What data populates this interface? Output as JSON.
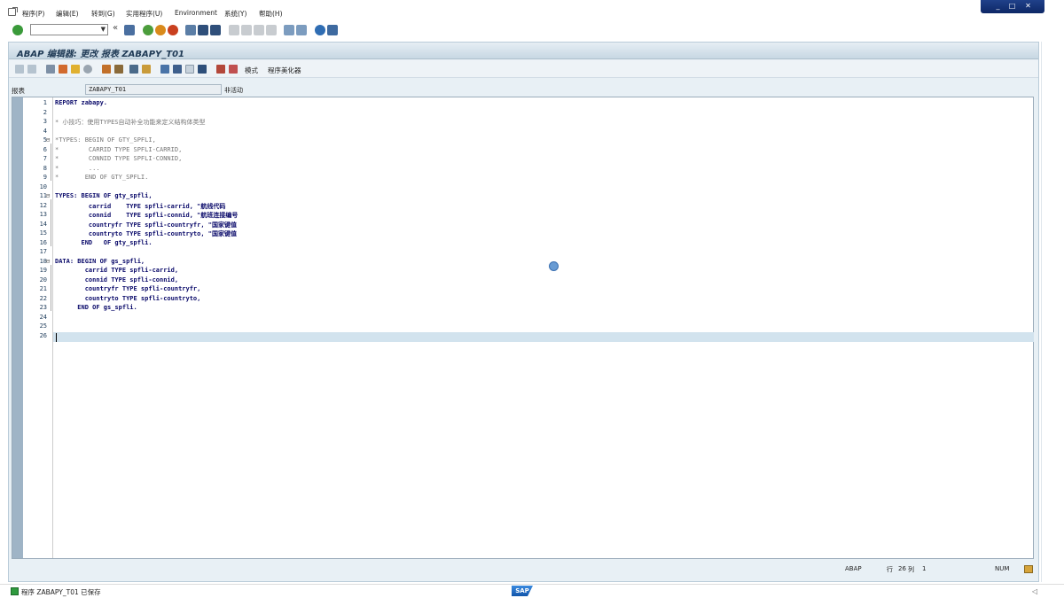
{
  "menubar": {
    "items": [
      "程序(P)",
      "编辑(E)",
      "转到(G)",
      "实用程序(U)",
      "Environment",
      "系统(Y)",
      "帮助(H)"
    ]
  },
  "window_controls": [
    "_",
    "□",
    "✕"
  ],
  "titlebar": {
    "title": "ABAP 编辑器: 更改 报表 ZABAPY_T01"
  },
  "app_toolbar": {
    "mode_label": "模式",
    "pretty_printer_label": "程序美化器"
  },
  "field": {
    "label": "报表",
    "value": "ZABAPY_T01",
    "status": "非活动"
  },
  "code_lines": [
    {
      "n": "1",
      "text": "REPORT zabapy."
    },
    {
      "n": "2",
      "text": ""
    },
    {
      "n": "3",
      "text": "* 小技巧：使用TYPES自动补全功能来定义结构体类型"
    },
    {
      "n": "4",
      "text": ""
    },
    {
      "n": "5",
      "text": "*TYPES: BEGIN OF GTY_SPFLI,"
    },
    {
      "n": "6",
      "text": "*        CARRID TYPE SPFLI-CARRID,"
    },
    {
      "n": "7",
      "text": "*        CONNID TYPE SPFLI-CONNID,"
    },
    {
      "n": "8",
      "text": "*        ..."
    },
    {
      "n": "9",
      "text": "*       END OF GTY_SPFLI."
    },
    {
      "n": "10",
      "text": ""
    },
    {
      "n": "11",
      "text": "TYPES: BEGIN OF gty_spfli,"
    },
    {
      "n": "12",
      "text": "         carrid    TYPE spfli-carrid, \"航线代码"
    },
    {
      "n": "13",
      "text": "         connid    TYPE spfli-connid, \"航班连接编号"
    },
    {
      "n": "14",
      "text": "         countryfr TYPE spfli-countryfr, \"国家键值"
    },
    {
      "n": "15",
      "text": "         countryto TYPE spfli-countryto, \"国家键值"
    },
    {
      "n": "16",
      "text": "       END   OF gty_spfli."
    },
    {
      "n": "17",
      "text": ""
    },
    {
      "n": "18",
      "text": "DATA: BEGIN OF gs_spfli,"
    },
    {
      "n": "19",
      "text": "        carrid TYPE spfli-carrid,"
    },
    {
      "n": "20",
      "text": "        connid TYPE spfli-connid,"
    },
    {
      "n": "21",
      "text": "        countryfr TYPE spfli-countryfr,"
    },
    {
      "n": "22",
      "text": "        countryto TYPE spfli-countryto,"
    },
    {
      "n": "23",
      "text": "      END OF gs_spfli."
    },
    {
      "n": "24",
      "text": ""
    },
    {
      "n": "25",
      "text": ""
    },
    {
      "n": "26",
      "text": ""
    }
  ],
  "editor_status": {
    "lang": "ABAP",
    "row_label": "行",
    "row": "26",
    "col_label": "列",
    "col": "1",
    "num": "NUM"
  },
  "statusbar": {
    "message": "程序 ZABAPY_T01 已保存",
    "sap_logo": "SAP"
  }
}
